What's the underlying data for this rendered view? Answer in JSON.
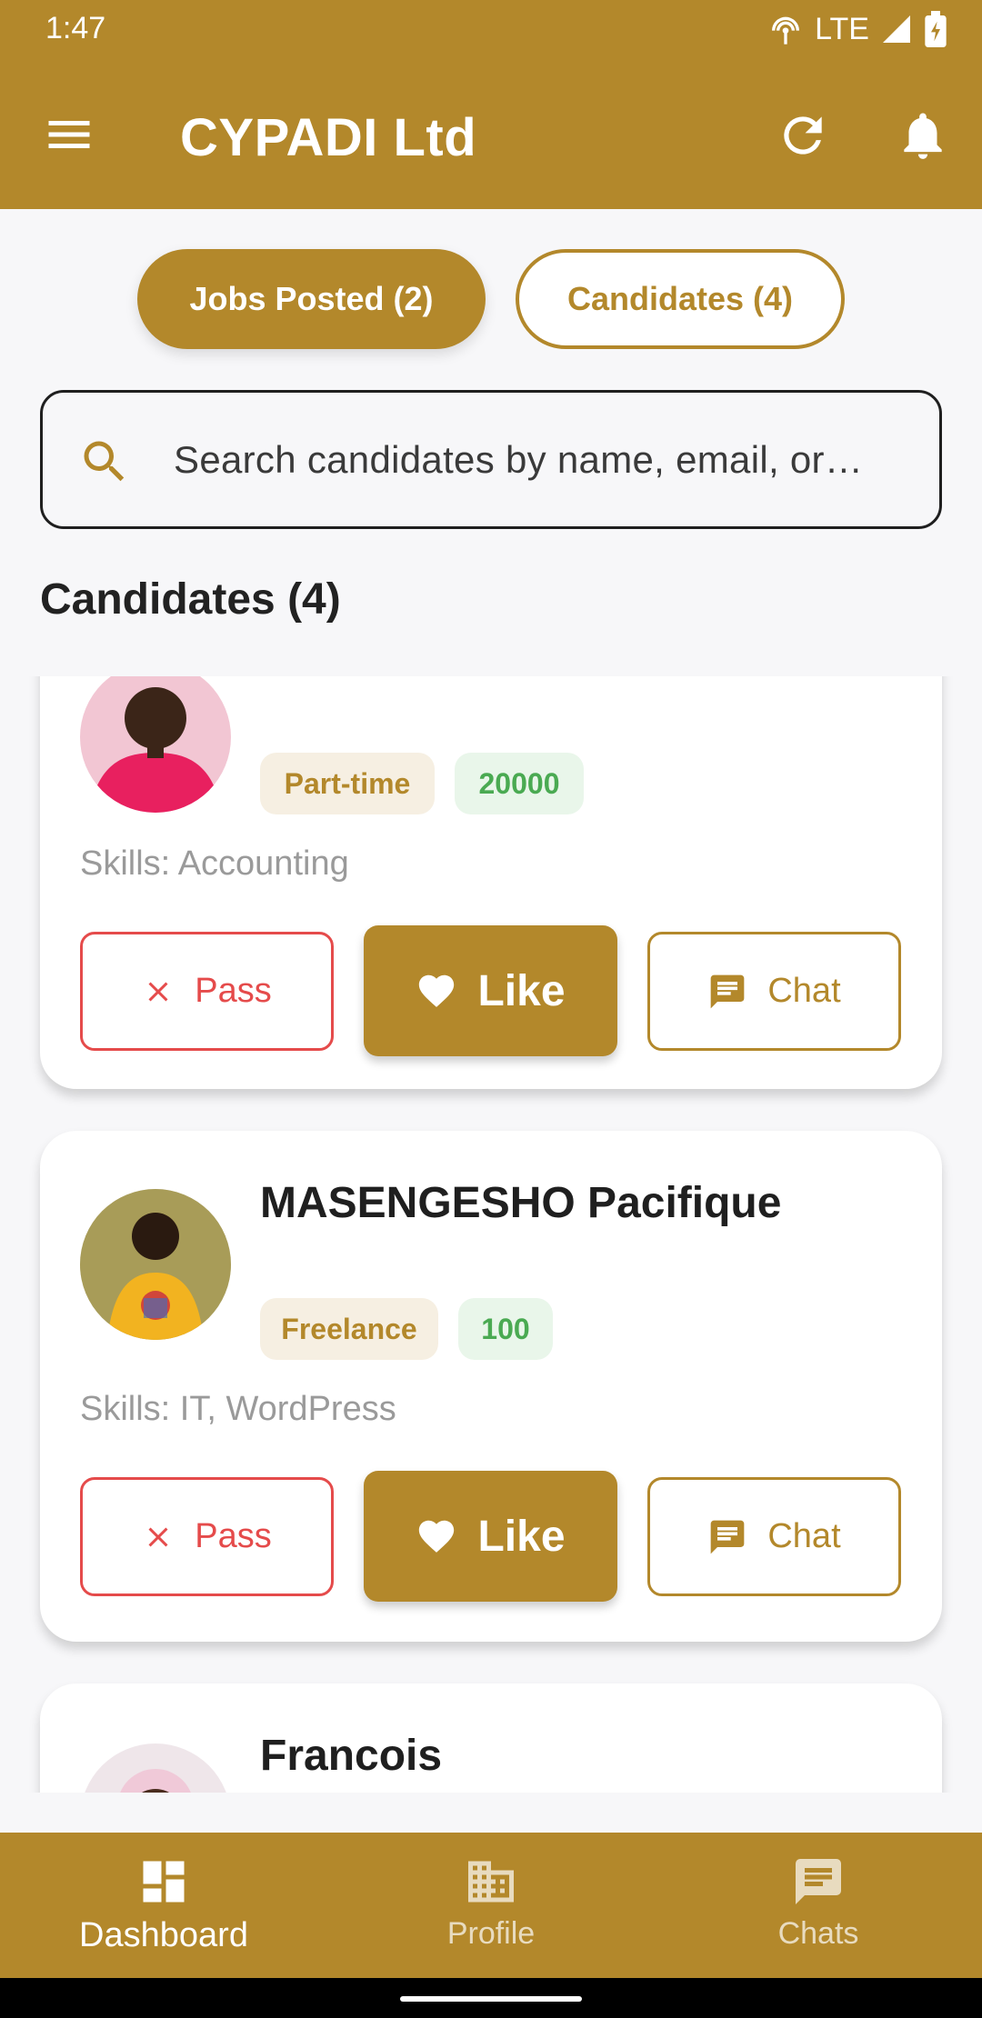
{
  "status_bar": {
    "time": "1:47",
    "network": "LTE"
  },
  "app_bar": {
    "title": "CYPADI Ltd"
  },
  "tabs": [
    {
      "label": "Jobs Posted (2)",
      "active": true
    },
    {
      "label": "Candidates (4)",
      "active": false
    }
  ],
  "search": {
    "placeholder": "Search candidates by name, email, or…"
  },
  "section": {
    "title": "Candidates (4)"
  },
  "candidates": [
    {
      "name": "",
      "type": "Part-time",
      "salary": "20000",
      "skills": "Skills: Accounting",
      "actions": {
        "pass": "Pass",
        "like": "Like",
        "chat": "Chat"
      }
    },
    {
      "name": "MASENGESHO Pacifique",
      "type": "Freelance",
      "salary": "100",
      "skills": "Skills: IT, WordPress",
      "actions": {
        "pass": "Pass",
        "like": "Like",
        "chat": "Chat"
      }
    },
    {
      "name": "Francois"
    }
  ],
  "bottom_nav": [
    {
      "label": "Dashboard",
      "icon": "dashboard-icon",
      "active": true
    },
    {
      "label": "Profile",
      "icon": "building-icon",
      "active": false
    },
    {
      "label": "Chats",
      "icon": "chat-icon",
      "active": false
    }
  ],
  "colors": {
    "primary": "#b3882b",
    "danger": "#e54b4b",
    "success": "#4aaa52"
  }
}
